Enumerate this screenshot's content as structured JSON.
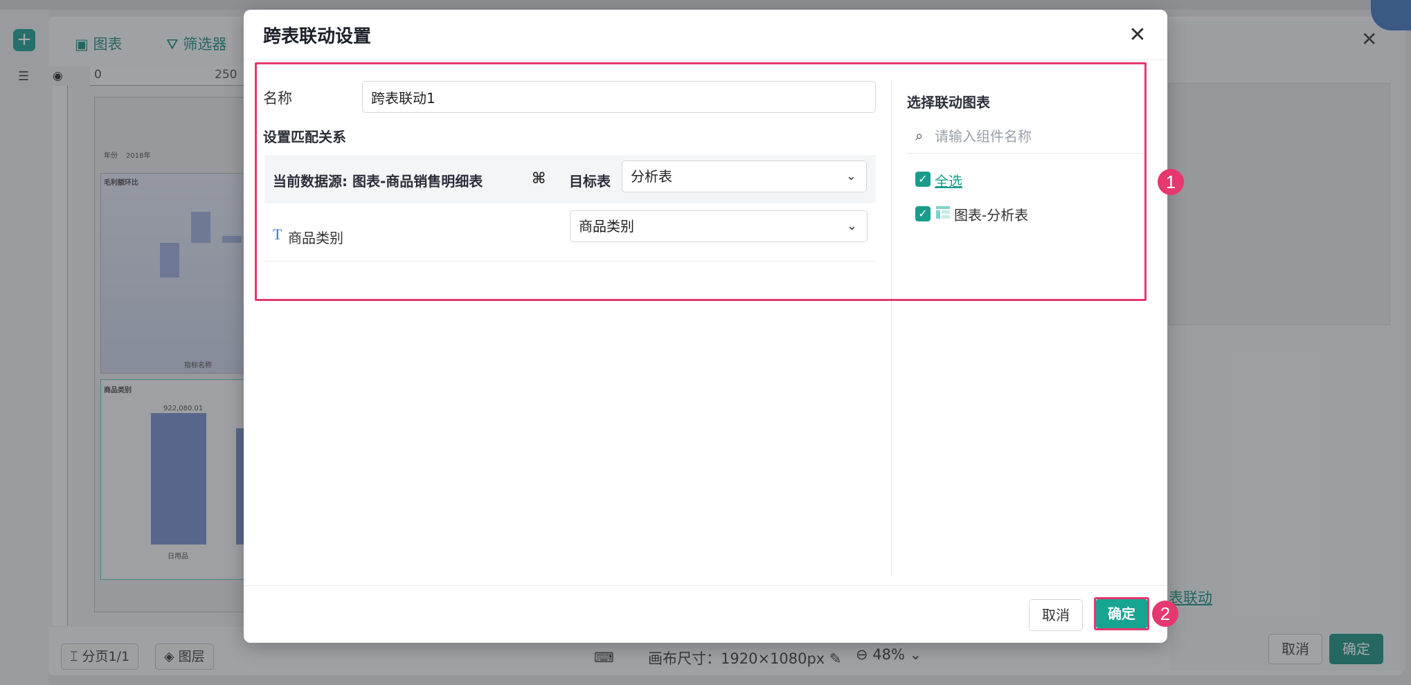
{
  "background": {
    "toolbar": {
      "chart_label": "图表",
      "filter_label": "筛选器"
    },
    "ruler": {
      "mark_0": "0",
      "mark_250": "250"
    },
    "canvas": {
      "chart1_title": "毛利额环比",
      "filter_label": "年份",
      "filter_value": "2018年",
      "chart2_title": "商品类别",
      "chart2_value_label": "922,080.01",
      "chart2_category": "日用品",
      "chart1_legend": "指标名称"
    },
    "right_panel": {
      "link_text": "表联动",
      "cancel_label": "取消",
      "ok_label": "确定"
    },
    "bottom": {
      "page_label": "分页1/1",
      "layer_label": "图层",
      "canvas_size": "画布尺寸：1920×1080px",
      "zoom": "48%"
    }
  },
  "modal": {
    "title": "跨表联动设置",
    "name_label": "名称",
    "name_value": "跨表联动1",
    "match_label": "设置匹配关系",
    "source_label": "当前数据源: 图表-商品销售明细表",
    "target_label": "目标表",
    "target_value": "分析表",
    "field_type_icon": "T",
    "field_name": "商品类别",
    "field_target_value": "商品类别",
    "right_title": "选择联动图表",
    "search_placeholder": "请输入组件名称",
    "select_all_label": "全选",
    "chart_item_label": "图表-分析表",
    "cancel_label": "取消",
    "ok_label": "确定"
  },
  "annotations": {
    "marker1": "1",
    "marker2": "2"
  },
  "colors": {
    "accent": "#17a592",
    "highlight": "#e5386e",
    "field_type": "#3d6fd8"
  }
}
